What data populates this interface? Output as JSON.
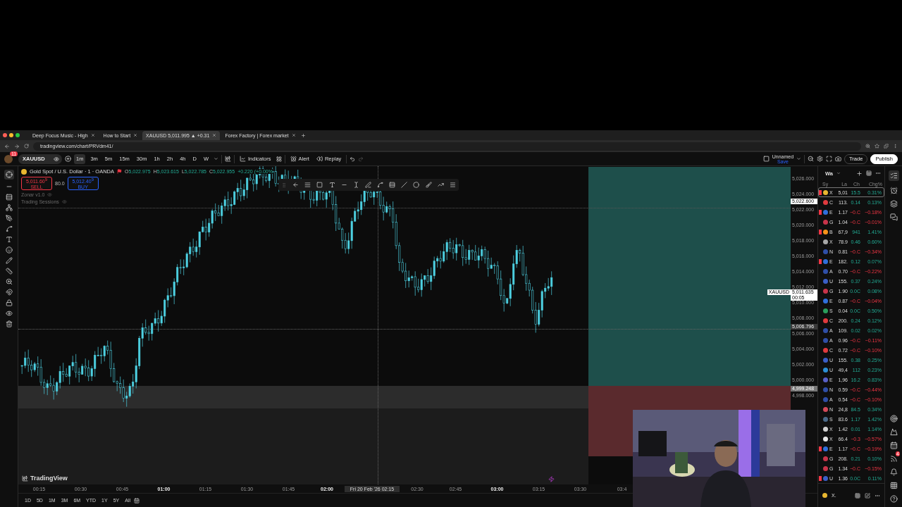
{
  "browser": {
    "tabs": [
      {
        "title": "Deep Focus Music - High",
        "selected": false
      },
      {
        "title": "How to Start",
        "selected": false
      },
      {
        "title": "XAUUSD 5,011.995 ▲ +0.31",
        "selected": true
      },
      {
        "title": "Forex Factory | Forex market",
        "selected": false
      }
    ],
    "url": "tradingview.com/chart/PRVdm41/"
  },
  "toolbar": {
    "notification_count": "11",
    "symbol": "XAUUSD",
    "timeframes": [
      {
        "label": "1m",
        "selected": true
      },
      {
        "label": "3m",
        "selected": false
      },
      {
        "label": "5m",
        "selected": false
      },
      {
        "label": "15m",
        "selected": false
      },
      {
        "label": "30m",
        "selected": false
      },
      {
        "label": "1h",
        "selected": false
      },
      {
        "label": "2h",
        "selected": false
      },
      {
        "label": "4h",
        "selected": false
      },
      {
        "label": "D",
        "selected": false
      },
      {
        "label": "W",
        "selected": false
      }
    ],
    "indicators_label": "Indicators",
    "alert_label": "Alert",
    "replay_label": "Replay",
    "layout_name": "Unnamed",
    "save_label": "Save",
    "trade_label": "Trade",
    "publish_label": "Publish"
  },
  "legend": {
    "title": "Gold Spot / U.S. Dollar · 1 · OANDA",
    "ohlc": [
      {
        "key": "O",
        "value": "5,022.975"
      },
      {
        "key": "H",
        "value": "5,023.615"
      },
      {
        "key": "L",
        "value": "5,022.785"
      },
      {
        "key": "C",
        "value": "5,022.955"
      }
    ],
    "change": "+0.220 (+0.00%",
    "sell": {
      "price": "5,011.60$^{9}$",
      "label": "SELL"
    },
    "spread": "80.0",
    "buy": {
      "price": "5,012.40$^{9}$",
      "label": "BUY"
    },
    "indicators": [
      "Zonar v1.0",
      "Trading Sessions"
    ]
  },
  "price_axis": {
    "ticks": [
      "5,026.000",
      "5,024.000",
      "5,022.000",
      "5,020.000",
      "5,018.000",
      "5,016.000",
      "5,014.000",
      "5,012.000",
      "5,010.000",
      "5,008.000",
      "5,006.000",
      "5,004.000",
      "5,002.000",
      "5,000.000",
      "4,998.000"
    ],
    "markers": [
      {
        "kind": "line",
        "value": "5,022.600"
      },
      {
        "kind": "last",
        "symbol": "XAUUSD",
        "value": "5,011.635",
        "countdown": "00:05"
      },
      {
        "kind": "crosshair",
        "value": "5,006.796"
      },
      {
        "kind": "zone",
        "value": "4,999.248"
      }
    ]
  },
  "time_axis": {
    "labels": [
      {
        "kind": "tick",
        "text": "00:15",
        "bold": false
      },
      {
        "kind": "tick",
        "text": "00:30",
        "bold": false
      },
      {
        "kind": "tick",
        "text": "00:45",
        "bold": false
      },
      {
        "kind": "tick",
        "text": "01:00",
        "bold": true
      },
      {
        "kind": "tick",
        "text": "01:15",
        "bold": false
      },
      {
        "kind": "tick",
        "text": "01:30",
        "bold": false
      },
      {
        "kind": "tick",
        "text": "01:45",
        "bold": false
      },
      {
        "kind": "tick",
        "text": "02:00",
        "bold": true
      },
      {
        "kind": "crosshair",
        "text": "Fri 20 Feb '26  02:15"
      },
      {
        "kind": "tick",
        "text": "02:30",
        "bold": false
      },
      {
        "kind": "tick",
        "text": "02:45",
        "bold": false
      },
      {
        "kind": "tick",
        "text": "03:00",
        "bold": true
      },
      {
        "kind": "tick",
        "text": "03:15",
        "bold": false
      },
      {
        "kind": "tick",
        "text": "03:30",
        "bold": false
      },
      {
        "kind": "tick",
        "text": "03:4",
        "bold": false
      }
    ]
  },
  "brand": "TradingView",
  "ranges": [
    "1D",
    "5D",
    "1M",
    "3M",
    "6M",
    "YTD",
    "1Y",
    "5Y",
    "All"
  ],
  "watchlist": {
    "title": "Wa",
    "columns": [
      "Sy",
      "La",
      "Ch",
      "Chg%"
    ],
    "footer": "X.",
    "rows": [
      {
        "symbol": "X",
        "last": "5,01",
        "chg": "15.5",
        "chg_pct": "0.31%",
        "negative": false,
        "flagged": true,
        "selected": true,
        "color": "#e8b630"
      },
      {
        "symbol": "C",
        "last": "113.",
        "chg": "0.14",
        "chg_pct": "0.13%",
        "negative": false,
        "flagged": false,
        "selected": false,
        "color": "#e03a3e"
      },
      {
        "symbol": "E",
        "last": "1.17",
        "chg": "−0.C",
        "chg_pct": "−0.18%",
        "negative": true,
        "flagged": true,
        "selected": false,
        "color": "#2f6fdc"
      },
      {
        "symbol": "G",
        "last": "1.04",
        "chg": "−0.C",
        "chg_pct": "−0.01%",
        "negative": true,
        "flagged": false,
        "selected": false,
        "color": "#c8344a"
      },
      {
        "symbol": "B",
        "last": "67,9",
        "chg": "941",
        "chg_pct": "1.41%",
        "negative": false,
        "flagged": true,
        "selected": false,
        "color": "#f7931a"
      },
      {
        "symbol": "X",
        "last": "78.9",
        "chg": "0.46",
        "chg_pct": "0.60%",
        "negative": false,
        "flagged": false,
        "selected": false,
        "color": "#a8a8a8"
      },
      {
        "symbol": "N",
        "last": "0.81",
        "chg": "−0.C",
        "chg_pct": "−0.34%",
        "negative": true,
        "flagged": false,
        "selected": false,
        "color": "#2f4fa8"
      },
      {
        "symbol": "E",
        "last": "182.",
        "chg": "0.12",
        "chg_pct": "0.07%",
        "negative": false,
        "flagged": true,
        "selected": false,
        "color": "#2f6fdc"
      },
      {
        "symbol": "A",
        "last": "0.70",
        "chg": "−0.C",
        "chg_pct": "−0.22%",
        "negative": true,
        "flagged": false,
        "selected": false,
        "color": "#2f4fa8"
      },
      {
        "symbol": "U",
        "last": "155.",
        "chg": "0.37",
        "chg_pct": "0.24%",
        "negative": false,
        "flagged": false,
        "selected": false,
        "color": "#3a5fc8"
      },
      {
        "symbol": "G",
        "last": "1.90",
        "chg": "0.0C",
        "chg_pct": "0.08%",
        "negative": false,
        "flagged": false,
        "selected": false,
        "color": "#c8344a"
      },
      {
        "symbol": "E",
        "last": "0.87",
        "chg": "−0.C",
        "chg_pct": "−0.04%",
        "negative": true,
        "flagged": false,
        "selected": false,
        "color": "#2f6fdc"
      },
      {
        "symbol": "S",
        "last": "0.04",
        "chg": "0.0C",
        "chg_pct": "0.50%",
        "negative": false,
        "flagged": false,
        "selected": false,
        "color": "#2a9d5c"
      },
      {
        "symbol": "C",
        "last": "200.",
        "chg": "0.24",
        "chg_pct": "0.12%",
        "negative": false,
        "flagged": false,
        "selected": false,
        "color": "#e03a3e"
      },
      {
        "symbol": "A",
        "last": "109.",
        "chg": "0.02",
        "chg_pct": "0.02%",
        "negative": false,
        "flagged": false,
        "selected": false,
        "color": "#2f4fa8"
      },
      {
        "symbol": "A",
        "last": "0.96",
        "chg": "−0.C",
        "chg_pct": "−0.11%",
        "negative": true,
        "flagged": false,
        "selected": false,
        "color": "#2f4fa8"
      },
      {
        "symbol": "C",
        "last": "0.72",
        "chg": "−0.C",
        "chg_pct": "−0.10%",
        "negative": true,
        "flagged": false,
        "selected": false,
        "color": "#e03a3e"
      },
      {
        "symbol": "U",
        "last": "155.",
        "chg": "0.38",
        "chg_pct": "0.25%",
        "negative": false,
        "flagged": false,
        "selected": false,
        "color": "#3a5fc8"
      },
      {
        "symbol": "U",
        "last": "49,4",
        "chg": "112",
        "chg_pct": "0.23%",
        "negative": false,
        "flagged": false,
        "selected": false,
        "color": "#2b8fd6"
      },
      {
        "symbol": "E",
        "last": "1,96",
        "chg": "16.2",
        "chg_pct": "0.83%",
        "negative": false,
        "flagged": false,
        "selected": false,
        "color": "#5860c8"
      },
      {
        "symbol": "N",
        "last": "0.59",
        "chg": "−0.C",
        "chg_pct": "−0.44%",
        "negative": true,
        "flagged": false,
        "selected": false,
        "color": "#2f4fa8"
      },
      {
        "symbol": "A",
        "last": "0.54",
        "chg": "−0.C",
        "chg_pct": "−0.10%",
        "negative": true,
        "flagged": false,
        "selected": false,
        "color": "#2f4fa8"
      },
      {
        "symbol": "N",
        "last": "24,8",
        "chg": "84.5",
        "chg_pct": "0.34%",
        "negative": false,
        "flagged": false,
        "selected": false,
        "color": "#d44a5a"
      },
      {
        "symbol": "S",
        "last": "83.6",
        "chg": "1.17",
        "chg_pct": "1.42%",
        "negative": false,
        "flagged": false,
        "selected": false,
        "color": "#4a6a8a"
      },
      {
        "symbol": "X",
        "last": "1.42",
        "chg": "0.01",
        "chg_pct": "1.14%",
        "negative": false,
        "flagged": false,
        "selected": false,
        "color": "#d0d0d0"
      },
      {
        "symbol": "X",
        "last": "66.4",
        "chg": "−0.3",
        "chg_pct": "−0.57%",
        "negative": true,
        "flagged": false,
        "selected": false,
        "color": "#e6e6e6"
      },
      {
        "symbol": "E",
        "last": "1.17",
        "chg": "−0.C",
        "chg_pct": "−0.19%",
        "negative": true,
        "flagged": true,
        "selected": false,
        "color": "#2f6fdc"
      },
      {
        "symbol": "G",
        "last": "208.",
        "chg": "0.21",
        "chg_pct": "0.10%",
        "negative": false,
        "flagged": false,
        "selected": false,
        "color": "#c8344a"
      },
      {
        "symbol": "G",
        "last": "1.34",
        "chg": "−0.C",
        "chg_pct": "−0.15%",
        "negative": true,
        "flagged": false,
        "selected": false,
        "color": "#c8344a"
      },
      {
        "symbol": "U",
        "last": "1.36",
        "chg": "0.0C",
        "chg_pct": "0.11%",
        "negative": false,
        "flagged": true,
        "selected": false,
        "color": "#3a5fc8"
      }
    ]
  },
  "side_panel": {
    "notification_count": "4"
  }
}
